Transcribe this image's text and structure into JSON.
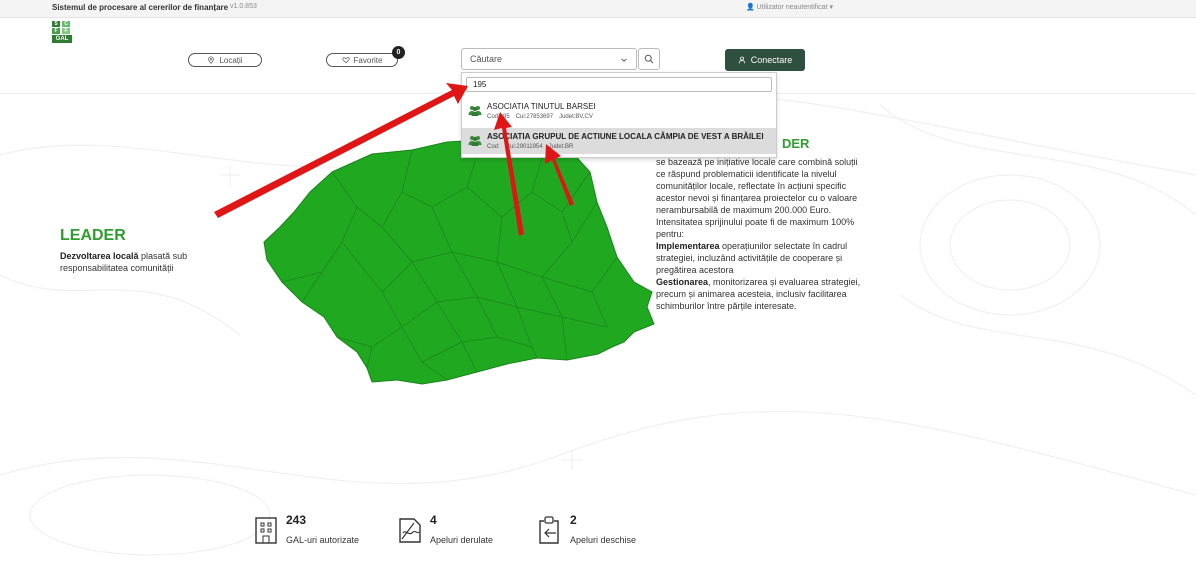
{
  "topbar": {
    "title": "Sistemul de procesare al cererilor de finanțare",
    "version": "v1.0.853",
    "user": "Utilizator neautentificat"
  },
  "header": {
    "logo": {
      "letters": [
        "S",
        "C",
        "F",
        "F"
      ],
      "text": "GAL"
    },
    "locations_label": "Locații",
    "favorites_label": "Favorite",
    "favorites_count": "0",
    "search_placeholder": "Căutare",
    "login_label": "Conectare"
  },
  "dropdown": {
    "query": "195",
    "results": [
      {
        "name": "ASOCIATIA TINUTUL BARSEI",
        "cod": "Cod:195",
        "cui": "Cui:27853697",
        "judet": "Judet:BV,CV"
      },
      {
        "name": "ASOCIATIA GRUPUL DE ACTIUNE LOCALA CÂMPIA DE VEST A BRĂILEI",
        "cod": "Cod:",
        "cui": "Cui:29011954",
        "judet": "Judet:BR"
      }
    ]
  },
  "hero_left": {
    "title": "LEADER",
    "desc_bold": "Dezvoltarea locală",
    "desc_rest": " plasată sub responsabilitatea comunității"
  },
  "hero_right": {
    "title": "DER",
    "p1": "se bazează pe inițiative locale care combină soluții ce răspund problematicii identificate la nivelul comunităților locale, reflectate în acțiuni specific acestor nevoi și finanțarea proiectelor cu o valoare nerambursabilă de maximum 200.000 Euro. Intensitatea sprijinului poate fi de maximum 100% pentru:",
    "b1": "Implementarea",
    "p2": " operațiunilor selectate în cadrul strategiei, incluzând activitățile de cooperare și pregătirea acestora",
    "b2": "Gestionarea",
    "p3": ", monitorizarea și evaluarea strategiei, precum și animarea acesteia, inclusiv facilitarea schimburilor între părțile interesate."
  },
  "stats": [
    {
      "number": "243",
      "label": "GAL-uri autorizate",
      "icon": "building-icon"
    },
    {
      "number": "4",
      "label": "Apeluri derulate",
      "icon": "document-signed-icon"
    },
    {
      "number": "2",
      "label": "Apeluri deschise",
      "icon": "clipboard-icon"
    }
  ],
  "colors": {
    "map_green": "#21a821",
    "leader_green": "#2e9e2e",
    "login_bg": "#2f4f3f",
    "arrow_red": "#e01515"
  }
}
